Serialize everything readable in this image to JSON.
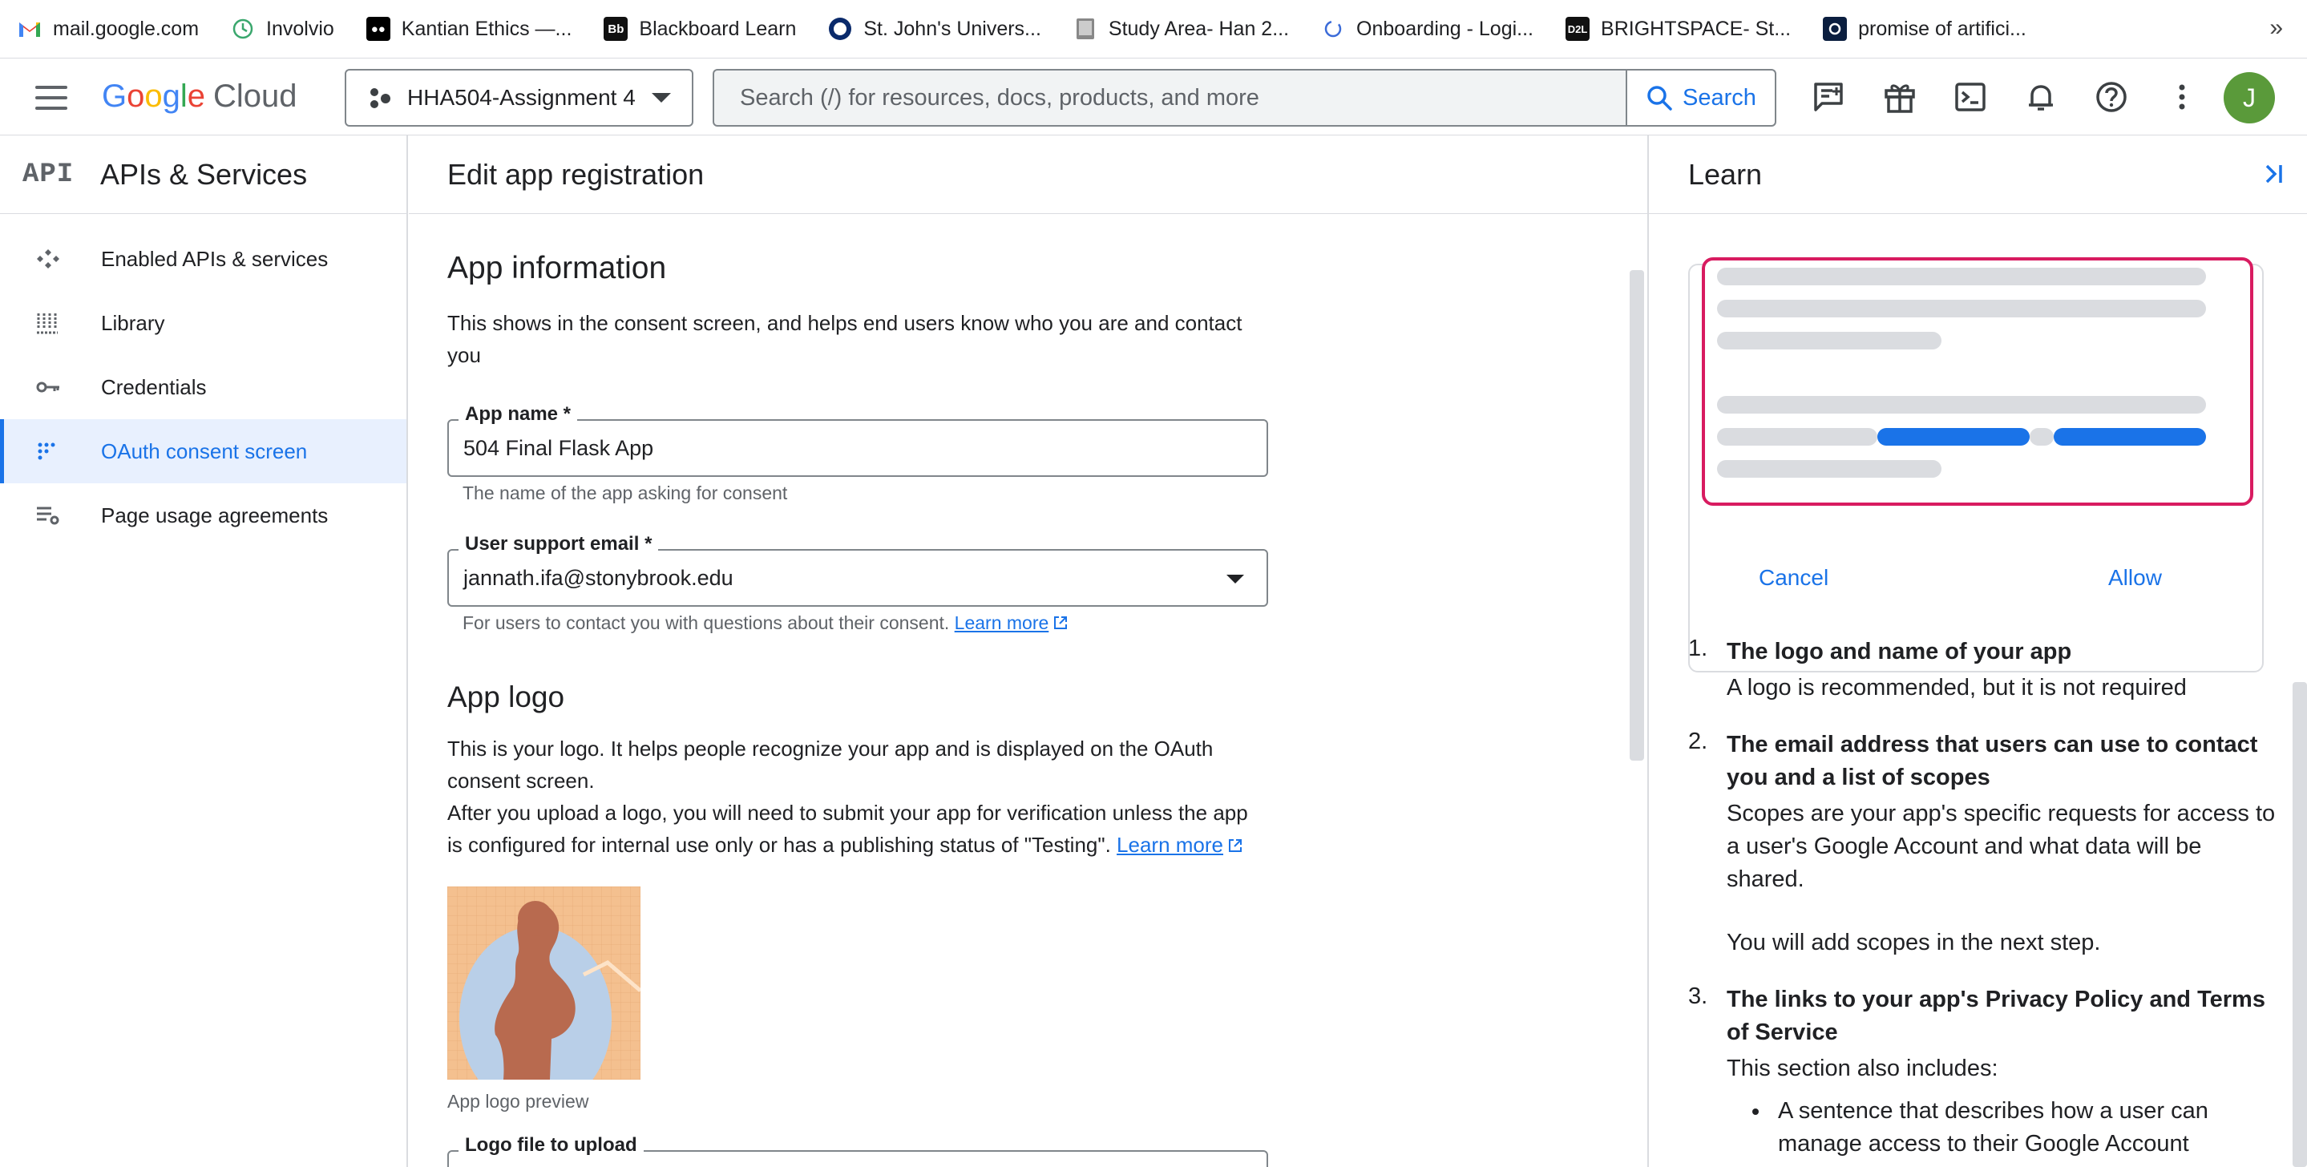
{
  "bookmarks": [
    {
      "label": "mail.google.com",
      "icon": "gmail-icon"
    },
    {
      "label": "Involvio",
      "icon": "involvio-icon"
    },
    {
      "label": "Kantian Ethics —...",
      "icon": "medium-icon"
    },
    {
      "label": "Blackboard Learn",
      "icon": "blackboard-icon"
    },
    {
      "label": "St. John's Univers...",
      "icon": "stjohns-icon"
    },
    {
      "label": "Study Area- Han 2...",
      "icon": "study-icon"
    },
    {
      "label": "Onboarding - Logi...",
      "icon": "onboarding-icon"
    },
    {
      "label": "BRIGHTSPACE- St...",
      "icon": "d2l-icon"
    },
    {
      "label": "promise of artifici...",
      "icon": "promise-icon"
    }
  ],
  "bookmarks_more": "»",
  "header": {
    "logo_google": [
      "G",
      "o",
      "o",
      "g",
      "l",
      "e"
    ],
    "logo_cloud": "Cloud",
    "project_name": "HHA504-Assignment 4",
    "search_placeholder": "Search (/) for resources, docs, products, and more",
    "search_button": "Search",
    "avatar_initial": "J"
  },
  "sidebar": {
    "api_badge": "API",
    "title": "APIs & Services",
    "items": [
      {
        "label": "Enabled APIs & services",
        "icon": "apis-icon"
      },
      {
        "label": "Library",
        "icon": "library-icon"
      },
      {
        "label": "Credentials",
        "icon": "key-icon"
      },
      {
        "label": "OAuth consent screen",
        "icon": "consent-icon",
        "active": true
      },
      {
        "label": "Page usage agreements",
        "icon": "agreements-icon"
      }
    ]
  },
  "main": {
    "title": "Edit app registration",
    "app_info": {
      "heading": "App information",
      "description": "This shows in the consent screen, and helps end users know who you are and contact you",
      "app_name_label": "App name *",
      "app_name_value": "504 Final Flask App",
      "app_name_helper": "The name of the app asking for consent",
      "support_email_label": "User support email *",
      "support_email_value": "jannath.ifa@stonybrook.edu",
      "support_email_helper": "For users to contact you with questions about their consent.",
      "learn_more": "Learn more"
    },
    "app_logo": {
      "heading": "App logo",
      "description_1": "This is your logo. It helps people recognize your app and is displayed on the OAuth consent screen.",
      "description_2": "After you upload a logo, you will need to submit your app for verification unless the app is configured for internal use only or has a publishing status of \"Testing\".",
      "learn_more": "Learn more",
      "preview_caption": "App logo preview",
      "upload_label": "Logo file to upload"
    }
  },
  "learn": {
    "title": "Learn",
    "cancel": "Cancel",
    "allow": "Allow",
    "steps": [
      {
        "num": "1.",
        "heading": "The logo and name of your app",
        "text": "A logo is recommended, but it is not required"
      },
      {
        "num": "2.",
        "heading": "The email address that users can use to contact you and a list of scopes",
        "text": "Scopes are your app's specific requests for access to a user's Google Account and what data will be shared.",
        "text2": "You will add scopes in the next step."
      },
      {
        "num": "3.",
        "heading": "The links to your app's Privacy Policy and Terms of Service",
        "text": "This section also includes:",
        "bullet": "A sentence that describes how a user can manage access to their Google Account"
      }
    ]
  },
  "colors": {
    "accent": "#1a73e8",
    "active_bg": "#e8f0fe",
    "consent_border": "#d81b60",
    "avatar": "#5a9a3a"
  }
}
